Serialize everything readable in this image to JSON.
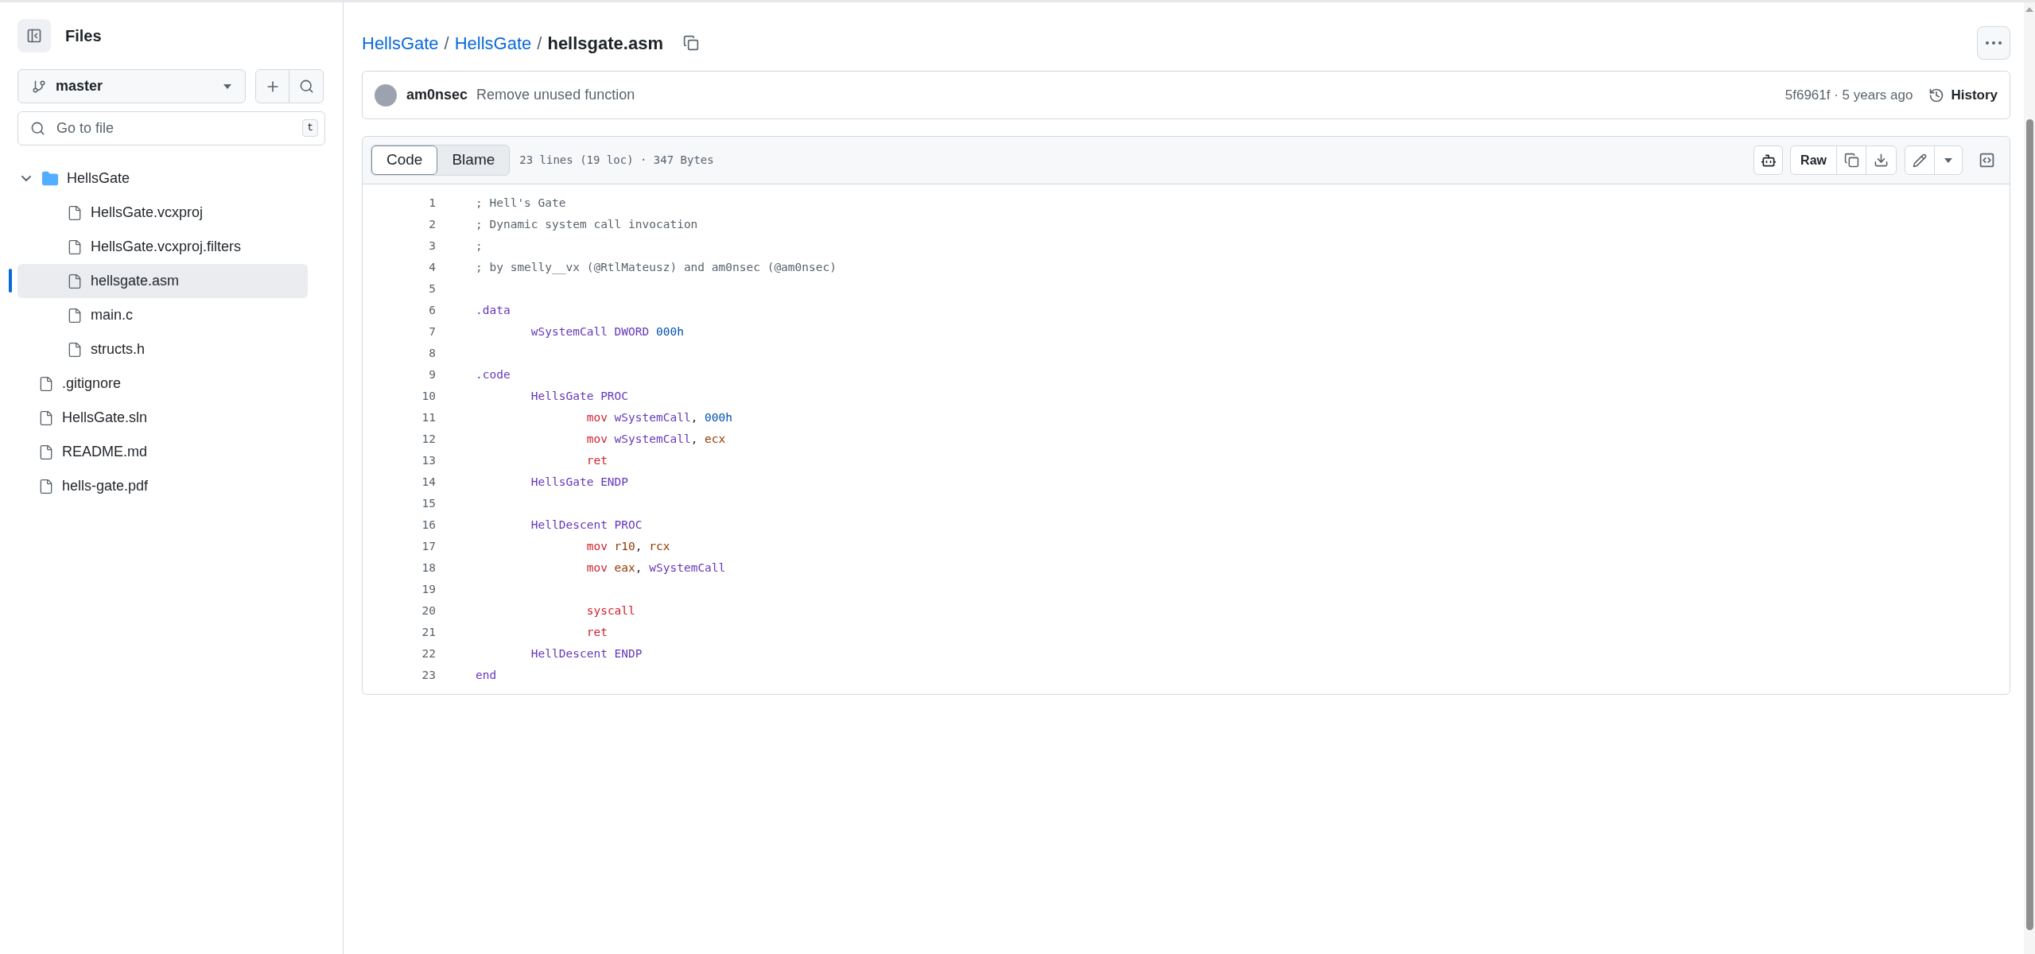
{
  "sidebar": {
    "title": "Files",
    "branch": "master",
    "search": {
      "placeholder": "Go to file",
      "shortcut": "t"
    },
    "tree": [
      {
        "name": "HellsGate",
        "kind": "folder",
        "expanded": true,
        "selected": false,
        "children": [
          {
            "name": "HellsGate.vcxproj",
            "kind": "file",
            "selected": false
          },
          {
            "name": "HellsGate.vcxproj.filters",
            "kind": "file",
            "selected": false
          },
          {
            "name": "hellsgate.asm",
            "kind": "file",
            "selected": true
          },
          {
            "name": "main.c",
            "kind": "file",
            "selected": false
          },
          {
            "name": "structs.h",
            "kind": "file",
            "selected": false
          }
        ]
      },
      {
        "name": ".gitignore",
        "kind": "file",
        "selected": false
      },
      {
        "name": "HellsGate.sln",
        "kind": "file",
        "selected": false
      },
      {
        "name": "README.md",
        "kind": "file",
        "selected": false
      },
      {
        "name": "hells-gate.pdf",
        "kind": "file",
        "selected": false
      }
    ]
  },
  "breadcrumb": [
    {
      "text": "HellsGate",
      "kind": "link"
    },
    {
      "text": "/",
      "kind": "separator"
    },
    {
      "text": "HellsGate",
      "kind": "link"
    },
    {
      "text": "/",
      "kind": "separator"
    },
    {
      "text": "hellsgate.asm",
      "kind": "current"
    }
  ],
  "commit": {
    "author": "am0nsec",
    "message": "Remove unused function",
    "sha": "5f6961f · 5 years ago",
    "history": "History"
  },
  "file": {
    "tabs": [
      {
        "label": "Code",
        "selected": true
      },
      {
        "label": "Blame",
        "selected": false
      }
    ],
    "info": "23 lines (19 loc) · 347 Bytes",
    "raw": "Raw",
    "lines": [
      {
        "number": "1",
        "tokens": [
          {
            "kind": "comment",
            "text": "; Hell's Gate"
          }
        ]
      },
      {
        "number": "2",
        "tokens": [
          {
            "kind": "comment",
            "text": "; Dynamic system call invocation"
          }
        ]
      },
      {
        "number": "3",
        "tokens": [
          {
            "kind": "comment",
            "text": ";"
          }
        ]
      },
      {
        "number": "4",
        "tokens": [
          {
            "kind": "comment",
            "text": "; by smelly__vx (@RtlMateusz) and am0nsec (@am0nsec)"
          }
        ]
      },
      {
        "number": "5"
      },
      {
        "number": "6",
        "tokens": [
          {
            "kind": "keyword",
            "text": ".data"
          }
        ]
      },
      {
        "number": "7",
        "tokens": [
          {
            "kind": "keyword",
            "text": "\twSystemCall DWORD "
          },
          {
            "kind": "number",
            "text": "000h"
          }
        ]
      },
      {
        "number": "8"
      },
      {
        "number": "9",
        "tokens": [
          {
            "kind": "keyword",
            "text": ".code"
          }
        ]
      },
      {
        "number": "10",
        "tokens": [
          {
            "kind": "keyword",
            "text": "\tHellsGate PROC"
          }
        ]
      },
      {
        "number": "11",
        "tokens": [
          {
            "kind": "instruction",
            "text": "\t\tmov "
          },
          {
            "kind": "keyword",
            "text": "wSystemCall"
          },
          {
            "kind": "plain",
            "text": ", "
          },
          {
            "kind": "number",
            "text": "000h"
          }
        ]
      },
      {
        "number": "12",
        "tokens": [
          {
            "kind": "instruction",
            "text": "\t\tmov "
          },
          {
            "kind": "keyword",
            "text": "wSystemCall"
          },
          {
            "kind": "plain",
            "text": ", "
          },
          {
            "kind": "register",
            "text": "ecx"
          }
        ]
      },
      {
        "number": "13",
        "tokens": [
          {
            "kind": "instruction",
            "text": "\t\tret"
          }
        ]
      },
      {
        "number": "14",
        "tokens": [
          {
            "kind": "keyword",
            "text": "\tHellsGate ENDP"
          }
        ]
      },
      {
        "number": "15"
      },
      {
        "number": "16",
        "tokens": [
          {
            "kind": "keyword",
            "text": "\tHellDescent PROC"
          }
        ]
      },
      {
        "number": "17",
        "tokens": [
          {
            "kind": "instruction",
            "text": "\t\tmov "
          },
          {
            "kind": "register",
            "text": "r10"
          },
          {
            "kind": "plain",
            "text": ", "
          },
          {
            "kind": "register",
            "text": "rcx"
          }
        ]
      },
      {
        "number": "18",
        "tokens": [
          {
            "kind": "instruction",
            "text": "\t\tmov "
          },
          {
            "kind": "register",
            "text": "eax"
          },
          {
            "kind": "plain",
            "text": ", "
          },
          {
            "kind": "keyword",
            "text": "wSystemCall"
          }
        ]
      },
      {
        "number": "19"
      },
      {
        "number": "20",
        "tokens": [
          {
            "kind": "instruction",
            "text": "\t\tsyscall"
          }
        ]
      },
      {
        "number": "21",
        "tokens": [
          {
            "kind": "instruction",
            "text": "\t\tret"
          }
        ]
      },
      {
        "number": "22",
        "tokens": [
          {
            "kind": "keyword",
            "text": "\tHellDescent ENDP"
          }
        ]
      },
      {
        "number": "23",
        "tokens": [
          {
            "kind": "keyword",
            "text": "end"
          }
        ]
      }
    ]
  }
}
